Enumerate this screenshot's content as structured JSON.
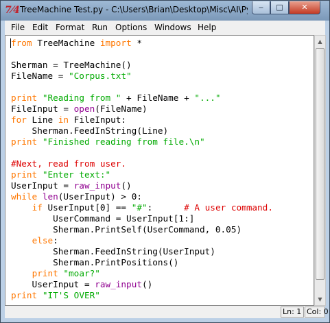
{
  "window": {
    "title": "TreeMachine Test.py - C:\\Users\\Brian\\Desktop\\Misc\\AI\\Python...",
    "icon": "python-idle-icon",
    "controls": {
      "minimize": "‒",
      "maximize": "□",
      "close": "✕"
    }
  },
  "menubar": {
    "items": [
      "File",
      "Edit",
      "Format",
      "Run",
      "Options",
      "Windows",
      "Help"
    ]
  },
  "code": {
    "lines": [
      [
        [
          "kw",
          "from"
        ],
        [
          "p",
          " TreeMachine "
        ],
        [
          "kw",
          "import"
        ],
        [
          "p",
          " *"
        ]
      ],
      [],
      [
        [
          "p",
          "Sherman = TreeMachine()"
        ]
      ],
      [
        [
          "p",
          "FileName = "
        ],
        [
          "str",
          "\"Corpus.txt\""
        ]
      ],
      [],
      [
        [
          "kw",
          "print"
        ],
        [
          "p",
          " "
        ],
        [
          "str",
          "\"Reading from \""
        ],
        [
          "p",
          " + FileName + "
        ],
        [
          "str",
          "\"...\""
        ]
      ],
      [
        [
          "p",
          "FileInput = "
        ],
        [
          "bi",
          "open"
        ],
        [
          "p",
          "(FileName)"
        ]
      ],
      [
        [
          "kw",
          "for"
        ],
        [
          "p",
          " Line "
        ],
        [
          "kw",
          "in"
        ],
        [
          "p",
          " FileInput:"
        ]
      ],
      [
        [
          "p",
          "    Sherman.FeedInString(Line)"
        ]
      ],
      [
        [
          "kw",
          "print"
        ],
        [
          "p",
          " "
        ],
        [
          "str",
          "\"Finished reading from file.\\n\""
        ]
      ],
      [],
      [
        [
          "cmt",
          "#Next, read from user."
        ]
      ],
      [
        [
          "kw",
          "print"
        ],
        [
          "p",
          " "
        ],
        [
          "str",
          "\"Enter text:\""
        ]
      ],
      [
        [
          "p",
          "UserInput = "
        ],
        [
          "bi",
          "raw_input"
        ],
        [
          "p",
          "()"
        ]
      ],
      [
        [
          "kw",
          "while"
        ],
        [
          "p",
          " "
        ],
        [
          "bi",
          "len"
        ],
        [
          "p",
          "(UserInput) > 0:"
        ]
      ],
      [
        [
          "p",
          "    "
        ],
        [
          "kw",
          "if"
        ],
        [
          "p",
          " UserInput[0] == "
        ],
        [
          "str",
          "\"#\""
        ],
        [
          "p",
          ":      "
        ],
        [
          "cmt",
          "# A user command."
        ]
      ],
      [
        [
          "p",
          "        UserCommand = UserInput[1:]"
        ]
      ],
      [
        [
          "p",
          "        Sherman.PrintSelf(UserCommand, 0.05)"
        ]
      ],
      [
        [
          "p",
          "    "
        ],
        [
          "kw",
          "else"
        ],
        [
          "p",
          ":"
        ]
      ],
      [
        [
          "p",
          "        Sherman.FeedInString(UserInput)"
        ]
      ],
      [
        [
          "p",
          "        Sherman.PrintPositions()"
        ]
      ],
      [
        [
          "p",
          "    "
        ],
        [
          "kw",
          "print"
        ],
        [
          "p",
          " "
        ],
        [
          "str",
          "\"moar?\""
        ]
      ],
      [
        [
          "p",
          "    UserInput = "
        ],
        [
          "bi",
          "raw_input"
        ],
        [
          "p",
          "()"
        ]
      ],
      [
        [
          "kw",
          "print"
        ],
        [
          "p",
          " "
        ],
        [
          "str",
          "\"IT'S OVER\""
        ]
      ]
    ]
  },
  "status": {
    "line": "Ln: 1",
    "col": "Col: 0"
  },
  "colors": {
    "keyword": "#ff7700",
    "string": "#00aa00",
    "comment": "#dd0000",
    "builtin": "#900090",
    "titlebar": "#8fa9c6"
  }
}
